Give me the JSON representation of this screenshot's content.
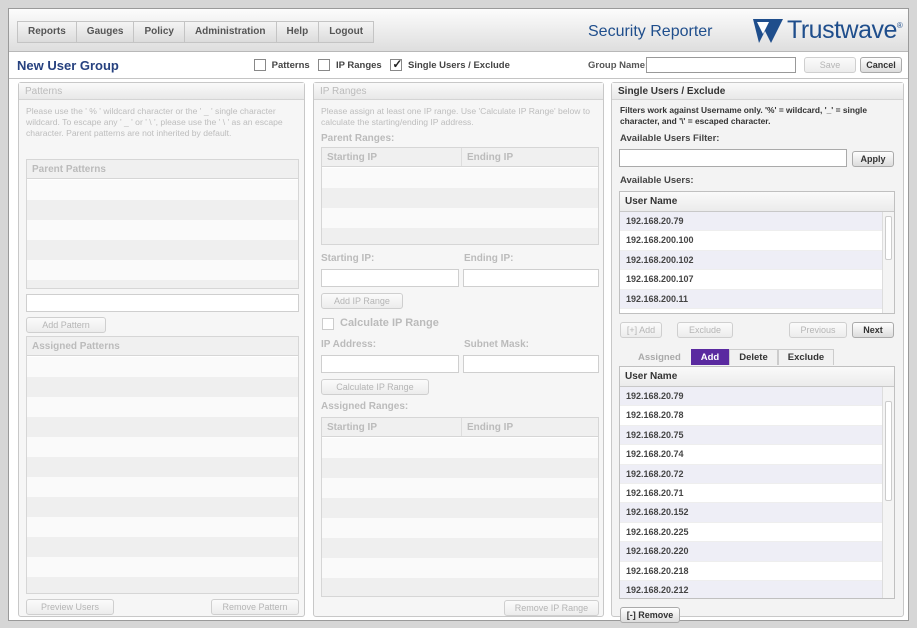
{
  "nav": {
    "items": [
      "Reports",
      "Gauges",
      "Policy",
      "Administration",
      "Help",
      "Logout"
    ]
  },
  "brand": {
    "product": "Security Reporter",
    "logo": "Trustwave",
    "logo_mark": "®"
  },
  "toolbar": {
    "title": "New User Group",
    "options": [
      {
        "label": "Patterns",
        "checked": false
      },
      {
        "label": "IP Ranges",
        "checked": false
      },
      {
        "label": "Single Users / Exclude",
        "checked": true
      }
    ],
    "group_name_label": "Group Name:",
    "group_name_value": "",
    "save_label": "Save",
    "cancel_label": "Cancel"
  },
  "patterns": {
    "title": "Patterns",
    "help": "Please use the ' % ' wildcard character or the ' _ ' single character wildcard. To escape any ' _ ' or ' \\ ', please use the ' \\ ' as an escape character. Parent patterns are not inherited by default.",
    "parent_header": "Parent Patterns",
    "add_pattern": "Add Pattern",
    "assigned_header": "Assigned Patterns",
    "preview_users": "Preview Users",
    "remove_pattern": "Remove Pattern"
  },
  "ip_ranges": {
    "title": "IP Ranges",
    "help": "Please assign at least one IP range. Use 'Calculate IP Range' below to calculate the starting/ending IP address.",
    "parent_ranges": "Parent Ranges:",
    "col_start": "Starting IP",
    "col_end": "Ending IP",
    "starting_ip_label": "Starting IP:",
    "ending_ip_label": "Ending IP:",
    "add_ip_range": "Add IP Range",
    "calculate_label": "Calculate IP Range",
    "ip_address_label": "IP Address:",
    "subnet_mask_label": "Subnet Mask:",
    "calculate_button": "Calculate IP Range",
    "assigned_ranges": "Assigned Ranges:",
    "remove_ip_range": "Remove IP Range"
  },
  "single_users": {
    "title": "Single Users / Exclude",
    "help": "Filters work against Username only. '%' = wildcard, '_' = single character, and '\\' = escaped character.",
    "filter_label": "Available Users Filter:",
    "filter_value": "",
    "apply": "Apply",
    "available_label": "Available Users:",
    "col_user": "User Name",
    "available_users": [
      "192.168.20.79",
      "192.168.200.100",
      "192.168.200.102",
      "192.168.200.107",
      "192.168.200.11"
    ],
    "add_btn": "[+] Add",
    "exclude_btn": "Exclude",
    "previous_btn": "Previous",
    "next_btn": "Next",
    "tabs": [
      "Assigned",
      "Add",
      "Delete",
      "Exclude"
    ],
    "active_tab": "Add",
    "assigned_users": [
      "192.168.20.79",
      "192.168.20.78",
      "192.168.20.75",
      "192.168.20.74",
      "192.168.20.72",
      "192.168.20.71",
      "192.168.20.152",
      "192.168.20.225",
      "192.168.20.220",
      "192.168.20.218",
      "192.168.20.212"
    ],
    "remove_btn": "[-] Remove"
  },
  "colors": {
    "accent": "#5a2aa0",
    "brand_blue": "#1f4e8c",
    "title_blue": "#26417f"
  }
}
